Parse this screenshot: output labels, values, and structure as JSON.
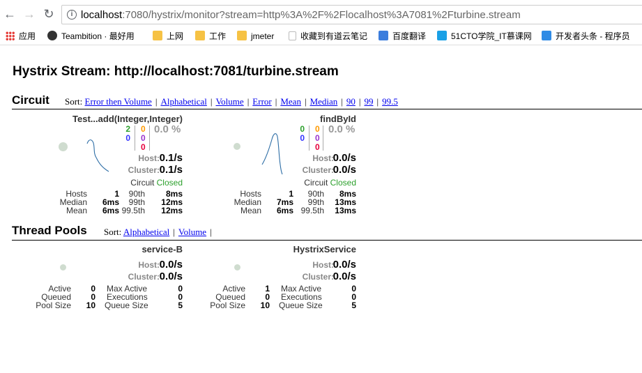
{
  "browser": {
    "nav": {
      "back_icon": "←",
      "forward_icon": "→",
      "reload_icon": "↻"
    },
    "url_host": "localhost",
    "url_rest": ":7080/hystrix/monitor?stream=http%3A%2F%2Flocalhost%3A7081%2Fturbine.stream",
    "bookmarks": [
      {
        "label": "应用",
        "icon": "apps-grid-icon"
      },
      {
        "label": "Teambition · 最好用",
        "icon": "teambition-icon"
      },
      {
        "label": "上网",
        "icon": "folder-icon"
      },
      {
        "label": "工作",
        "icon": "folder-icon"
      },
      {
        "label": "jmeter",
        "icon": "folder-icon"
      },
      {
        "label": "收藏到有道云笔记",
        "icon": "page-icon"
      },
      {
        "label": "百度翻译",
        "icon": "baidu-translate-icon"
      },
      {
        "label": "51CTO学院_IT慕课网",
        "icon": "51cto-icon"
      },
      {
        "label": "开发者头条 - 程序员",
        "icon": "toutiao-icon"
      }
    ]
  },
  "page": {
    "title": "Hystrix Stream: http://localhost:7081/turbine.stream",
    "circuit": {
      "heading": "Circuit",
      "sort_label": "Sort:",
      "sort_links": [
        "Error then Volume",
        "Alphabetical",
        "Volume",
        "Error",
        "Mean",
        "Median",
        "90",
        "99",
        "99.5"
      ],
      "cards": [
        {
          "name": "Test...add(Integer,Integer)",
          "c_green": "2",
          "c_blue": "0",
          "c_orange": "0",
          "c_purple": "0",
          "c_red": "0",
          "error_pct": "0.0 %",
          "host_label": "Host:",
          "host_value": "0.1/s",
          "cluster_label": "Cluster:",
          "cluster_value": "0.1/s",
          "circuit_label": "Circuit",
          "circuit_status": "Closed",
          "stats": {
            "hosts_label": "Hosts",
            "hosts": "1",
            "median_label": "Median",
            "median": "6ms",
            "mean_label": "Mean",
            "mean": "6ms",
            "p90_label": "90th",
            "p90": "8ms",
            "p99_label": "99th",
            "p99": "12ms",
            "p995_label": "99.5th",
            "p995": "12ms"
          }
        },
        {
          "name": "findById",
          "c_green": "0",
          "c_blue": "0",
          "c_orange": "0",
          "c_purple": "0",
          "c_red": "0",
          "error_pct": "0.0 %",
          "host_label": "Host:",
          "host_value": "0.0/s",
          "cluster_label": "Cluster:",
          "cluster_value": "0.0/s",
          "circuit_label": "Circuit",
          "circuit_status": "Closed",
          "stats": {
            "hosts_label": "Hosts",
            "hosts": "1",
            "median_label": "Median",
            "median": "7ms",
            "mean_label": "Mean",
            "mean": "6ms",
            "p90_label": "90th",
            "p90": "8ms",
            "p99_label": "99th",
            "p99": "13ms",
            "p995_label": "99.5th",
            "p995": "13ms"
          }
        }
      ]
    },
    "threadpools": {
      "heading": "Thread Pools",
      "sort_label": "Sort:",
      "sort_links": [
        "Alphabetical",
        "Volume"
      ],
      "cards": [
        {
          "name": "service-B",
          "host_label": "Host:",
          "host_value": "0.0/s",
          "cluster_label": "Cluster:",
          "cluster_value": "0.0/s",
          "active_label": "Active",
          "active": "0",
          "queued_label": "Queued",
          "queued": "0",
          "pool_size_label": "Pool Size",
          "pool_size": "10",
          "max_active_label": "Max Active",
          "max_active": "0",
          "executions_label": "Executions",
          "executions": "0",
          "queue_size_label": "Queue Size",
          "queue_size": "5"
        },
        {
          "name": "HystrixService",
          "host_label": "Host:",
          "host_value": "0.0/s",
          "cluster_label": "Cluster:",
          "cluster_value": "0.0/s",
          "active_label": "Active",
          "active": "1",
          "queued_label": "Queued",
          "queued": "0",
          "pool_size_label": "Pool Size",
          "pool_size": "10",
          "max_active_label": "Max Active",
          "max_active": "0",
          "executions_label": "Executions",
          "executions": "0",
          "queue_size_label": "Queue Size",
          "queue_size": "5"
        }
      ]
    },
    "colors": {
      "green": "#2ca02c",
      "blue": "#3333ff",
      "orange": "#ff9900",
      "purple": "#9933cc",
      "red": "#e6003c",
      "closed": "#2ca02c",
      "gray": "#999999",
      "link": "#0000ee"
    }
  }
}
